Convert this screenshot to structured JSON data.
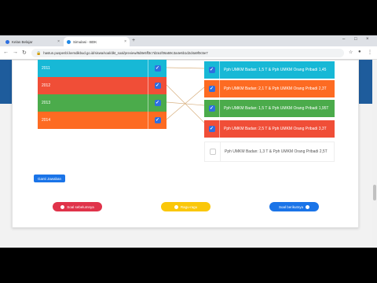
{
  "browser": {
    "tabs": [
      {
        "label": "Kelas Belajar",
        "active": false,
        "favicon_color": "#2d6fe0"
      },
      {
        "label": "Simulasi - BDK",
        "active": true,
        "favicon_color": "#1e88e5"
      }
    ],
    "url": "hastun.puspenbl.kemdikbud.go.id/siswa/soal/dkt_soal/preview/8d8e5ff3c7d2a1f06a59c3a4e6b1d2d4a9f0c5e7"
  },
  "left_items": [
    {
      "label": "2011",
      "color": "#17b8d6",
      "checked": true
    },
    {
      "label": "2012",
      "color": "#f04e37",
      "checked": true
    },
    {
      "label": "2013",
      "color": "#4bab4b",
      "checked": true
    },
    {
      "label": "2014",
      "color": "#fd6b22",
      "checked": true
    }
  ],
  "right_items": [
    {
      "label": "Pph UMKM Badan: 1,5 T & Pph UMKM Orang Pribadi 1,45",
      "color": "#17b8d6",
      "checked": true
    },
    {
      "label": "Pph UMKM Badan: 2,1 T & Pph UMKM Orang Pribadi 2,3T",
      "color": "#fd6b22",
      "checked": true
    },
    {
      "label": "Pph UMKM Badan: 1,5 T & Pph UMKM Orang Pribadi 1,95T",
      "color": "#4bab4b",
      "checked": true
    },
    {
      "label": "Pph UMKM Badan: 2,5 T & Pph UMKM Orang Pribadi 3,3T",
      "color": "#f04e37",
      "checked": true
    },
    {
      "label": "Pph UMKM Badan: 1,3 T & Pph UMKM Orang Pribadi 2,5T",
      "color": "#ffffff",
      "checked": false
    }
  ],
  "buttons": {
    "change_answer": "Ganti Jawaban",
    "previous": "Soal sebelumnya",
    "doubtful": "Ragu-ragu",
    "next": "Soal berikutnya"
  }
}
